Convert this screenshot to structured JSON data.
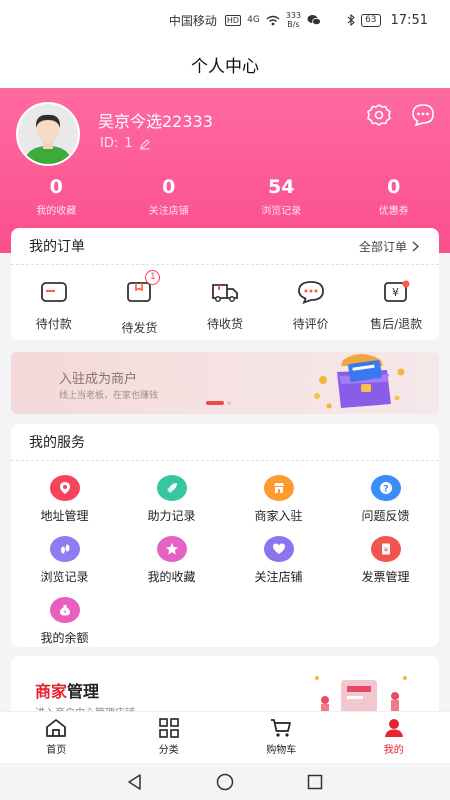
{
  "status_bar": {
    "carrier": "中国移动",
    "hd": "HD",
    "network": "4G",
    "speed_value": "333",
    "speed_unit": "B/s",
    "battery": "63",
    "time": "17:51"
  },
  "header": {
    "title": "个人中心"
  },
  "profile": {
    "username": "吴京今选22333",
    "id_label": "ID:",
    "id_value": "1"
  },
  "stats": [
    {
      "value": "0",
      "label": "我的收藏"
    },
    {
      "value": "0",
      "label": "关注店铺"
    },
    {
      "value": "54",
      "label": "浏览记录"
    },
    {
      "value": "0",
      "label": "优惠券"
    }
  ],
  "orders": {
    "title": "我的订单",
    "all_link": "全部订单",
    "items": [
      {
        "label": "待付款",
        "icon": "wallet-icon"
      },
      {
        "label": "待发货",
        "icon": "package-icon",
        "badge": "1"
      },
      {
        "label": "待收货",
        "icon": "truck-icon"
      },
      {
        "label": "待评价",
        "icon": "chat-bubble-icon"
      },
      {
        "label": "售后/退款",
        "icon": "refund-icon"
      }
    ]
  },
  "banner": {
    "title": "入驻成为商户",
    "subtitle": "线上当老板，在家也赚钱"
  },
  "services": {
    "title": "我的服务",
    "items": [
      {
        "label": "地址管理",
        "icon": "location-icon",
        "color": "#f5455c"
      },
      {
        "label": "助力记录",
        "icon": "rocket-icon",
        "color": "#37c6a0"
      },
      {
        "label": "商家入驻",
        "icon": "store-icon",
        "color": "#ff9a2e"
      },
      {
        "label": "问题反馈",
        "icon": "question-icon",
        "color": "#3b8ef5"
      },
      {
        "label": "浏览记录",
        "icon": "footprint-icon",
        "color": "#8e7cf0"
      },
      {
        "label": "我的收藏",
        "icon": "star-icon",
        "color": "#e561c4"
      },
      {
        "label": "关注店铺",
        "icon": "heart-icon",
        "color": "#8d74ee"
      },
      {
        "label": "发票管理",
        "icon": "invoice-icon",
        "color": "#f0554f"
      },
      {
        "label": "我的余额",
        "icon": "money-bag-icon",
        "color": "#e85fc0"
      }
    ]
  },
  "merchant": {
    "title_accent": "商家",
    "title_rest": "管理",
    "subtitle": "进入商户中心管理店铺"
  },
  "tabbar": [
    {
      "label": "首页",
      "icon": "home-icon"
    },
    {
      "label": "分类",
      "icon": "grid-icon"
    },
    {
      "label": "购物车",
      "icon": "cart-icon"
    },
    {
      "label": "我的",
      "icon": "user-icon",
      "active": true
    }
  ],
  "colors": {
    "brand_pink": "#fb4f8d",
    "accent_red": "#e8232e"
  }
}
